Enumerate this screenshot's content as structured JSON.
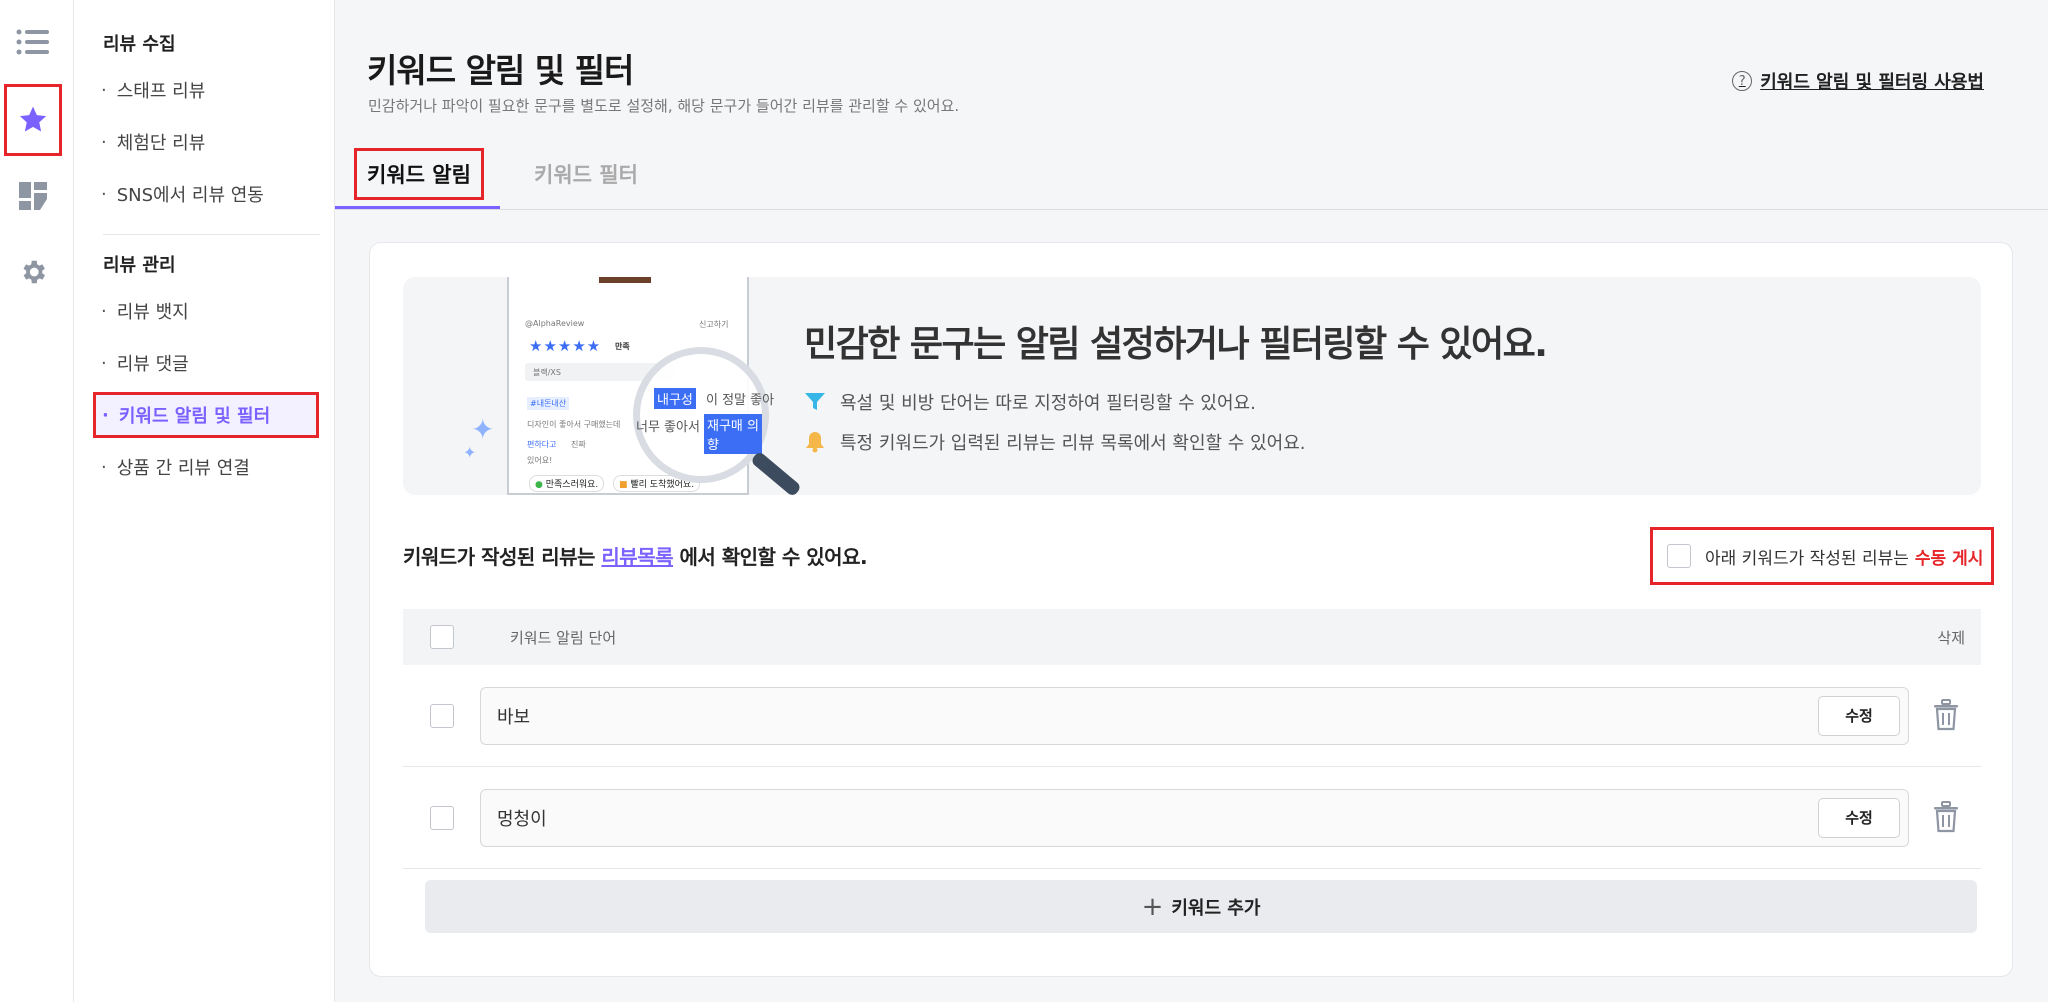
{
  "rail": {
    "items": [
      {
        "name": "list-icon",
        "active": false
      },
      {
        "name": "star-icon",
        "active": true
      },
      {
        "name": "dashboard-icon",
        "active": false
      },
      {
        "name": "gear-icon",
        "active": false
      }
    ]
  },
  "subnav": {
    "section1_title": "리뷰 수집",
    "section1_items": [
      "스태프 리뷰",
      "체험단 리뷰",
      "SNS에서 리뷰 연동"
    ],
    "section2_title": "리뷰 관리",
    "section2_items": [
      "리뷰 뱃지",
      "리뷰 댓글",
      "키워드 알림 및 필터",
      "상품 간 리뷰 연결"
    ],
    "active_item": "키워드 알림 및 필터"
  },
  "header": {
    "title": "키워드 알림 및 필터",
    "description": "민감하거나 파악이 필요한 문구를 별도로 설정해, 해당 문구가 들어간 리뷰를 관리할 수 있어요.",
    "help_link": "키워드 알림 및 필터링 사용법"
  },
  "tabs": [
    {
      "label": "키워드 알림",
      "active": true
    },
    {
      "label": "키워드 필터",
      "active": false
    }
  ],
  "banner": {
    "title": "민감한 문구는 알림 설정하거나 필터링할 수 있어요.",
    "line1": "욕설 및 비방 단어는 따로 지정하여 필터링할 수 있어요.",
    "line2": "특정 키워드가 입력된 리뷰는 리뷰 목록에서 확인할 수 있어요.",
    "illustration": {
      "reviewer": "@AlphaReview",
      "report": "신고하기",
      "rating_label": "만족",
      "option": "블랙/XS",
      "tag": "#내돈내산",
      "snippet1": "디자인이 좋아서 구매했는데",
      "snippet2": "편하다고",
      "snippet3": "진짜",
      "snippet4": "있어요!",
      "bubble1": "만족스러워요.",
      "bubble2": "빨리 도착했어요.",
      "mag_hl1": "내구성",
      "mag_tx1": "이 정말 좋아",
      "mag_tx2": "너무 좋아서",
      "mag_hl2": "재구매 의향"
    }
  },
  "notice": {
    "prefix": "키워드가 작성된 리뷰는",
    "link": "리뷰목록",
    "suffix": "에서 확인할 수 있어요."
  },
  "manual_post": {
    "label": "아래 키워드가 작성된 리뷰는",
    "highlight": "수동 게시"
  },
  "table": {
    "col_word": "키워드 알림 단어",
    "col_delete": "삭제",
    "rows": [
      {
        "keyword": "바보",
        "edit_label": "수정"
      },
      {
        "keyword": "멍청이",
        "edit_label": "수정"
      }
    ]
  },
  "add_button": "키워드 추가",
  "colors": {
    "accent": "#7b61ff",
    "highlight_red": "#e5252a",
    "star_blue": "#3b6ef5",
    "funnel": "#35b6e6",
    "bell": "#f5b64a"
  }
}
